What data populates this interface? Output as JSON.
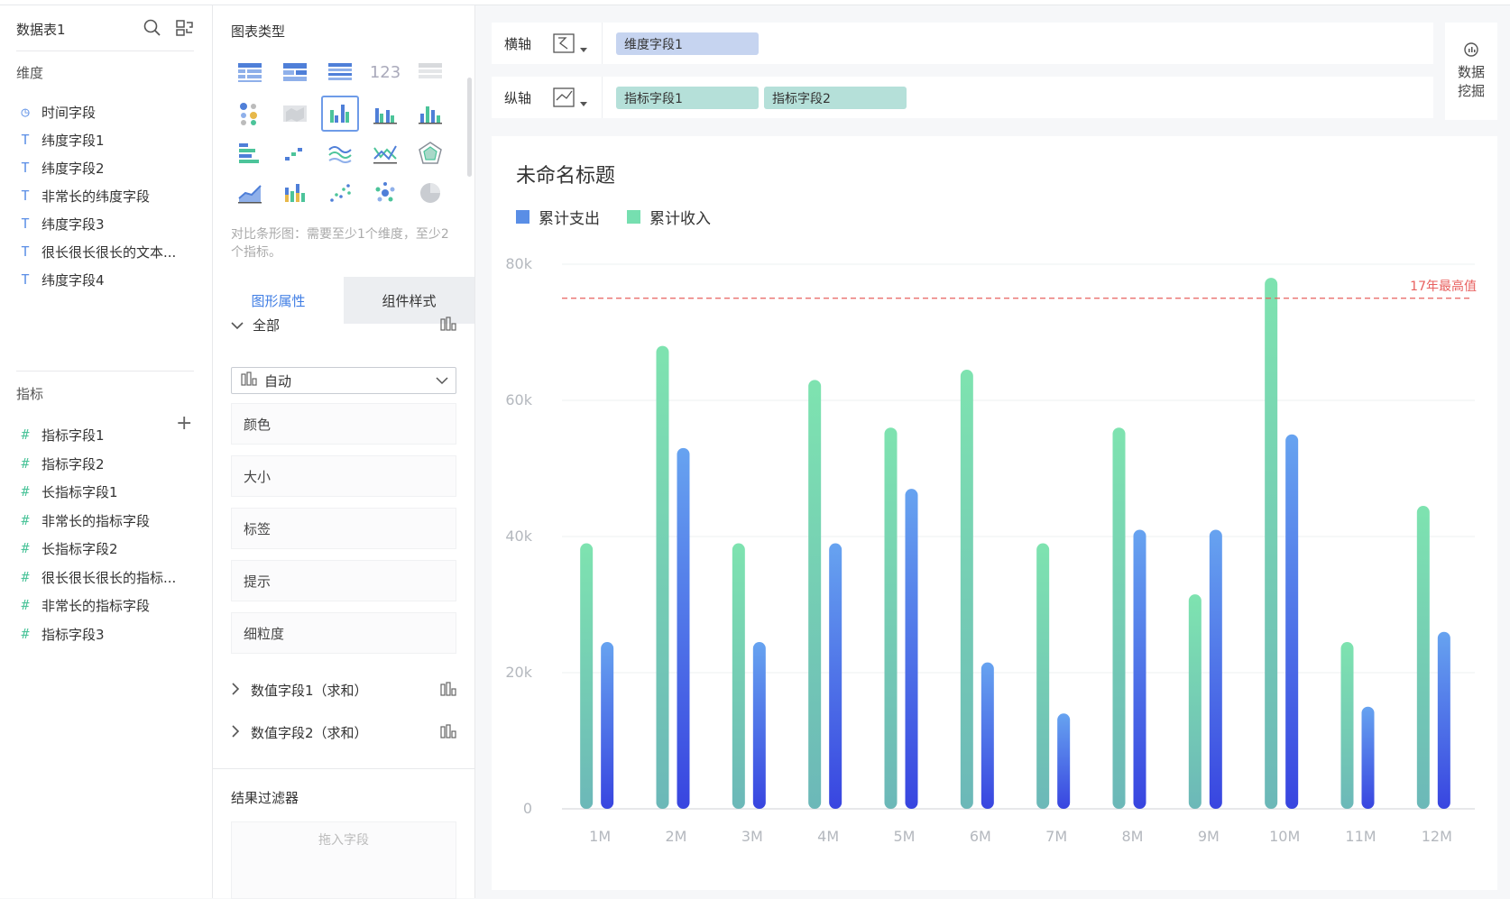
{
  "left_panel": {
    "title": "数据表1",
    "dimension_section": "维度",
    "dimensions": [
      {
        "icon": "clock-icon",
        "glyph": "◷",
        "label": "时间字段"
      },
      {
        "icon": "text-type-icon",
        "glyph": "T",
        "label": "纬度字段1"
      },
      {
        "icon": "text-type-icon",
        "glyph": "T",
        "label": "纬度字段2"
      },
      {
        "icon": "text-type-icon",
        "glyph": "T",
        "label": "非常长的纬度字段"
      },
      {
        "icon": "text-type-icon",
        "glyph": "T",
        "label": "纬度字段3"
      },
      {
        "icon": "text-type-icon",
        "glyph": "T",
        "label": "很长很长很长的文本..."
      },
      {
        "icon": "text-type-icon",
        "glyph": "T",
        "label": "纬度字段4"
      }
    ],
    "metric_section": "指标",
    "add_glyph": "+",
    "metrics": [
      {
        "glyph": "#",
        "label": "指标字段1"
      },
      {
        "glyph": "#",
        "label": "指标字段2"
      },
      {
        "glyph": "#",
        "label": "长指标字段1"
      },
      {
        "glyph": "#",
        "label": "非常长的指标字段"
      },
      {
        "glyph": "#",
        "label": "长指标字段2"
      },
      {
        "glyph": "#",
        "label": "很长很长很长的指标..."
      },
      {
        "glyph": "#",
        "label": "非常长的指标字段"
      },
      {
        "glyph": "#",
        "label": "指标字段3"
      }
    ]
  },
  "middle_panel": {
    "chart_type_title": "图表类型",
    "chart_type_hint": "对比条形图：需要至少1个维度，至少2个指标。",
    "tab_graphic": "图形属性",
    "tab_component": "组件样式",
    "all_label": "全部",
    "auto_select": "自动",
    "props": [
      "颜色",
      "大小",
      "标签",
      "提示",
      "细粒度"
    ],
    "value_field_1": "数值字段1（求和）",
    "value_field_2": "数值字段2（求和）",
    "filter_title": "结果过滤器",
    "drop_placeholder": "拖入字段"
  },
  "axes": {
    "x_label": "横轴",
    "x_field": "维度字段1",
    "y_label": "纵轴",
    "y_field_1": "指标字段1",
    "y_field_2": "指标字段2"
  },
  "data_mining": {
    "line1": "数据",
    "line2": "挖掘"
  },
  "colors": {
    "accent": "#3f7de4",
    "income_top": "#7ee3b0",
    "income_bottom": "#6cb8b8",
    "expense_top": "#67a3f0",
    "expense_bottom": "#3845e0",
    "refline": "#e8605f"
  },
  "chart_data": {
    "type": "bar",
    "title": "未命名标题",
    "categories": [
      "1M",
      "2M",
      "3M",
      "4M",
      "5M",
      "6M",
      "7M",
      "8M",
      "9M",
      "10M",
      "11M",
      "12M"
    ],
    "series": [
      {
        "name": "累计收入",
        "values": [
          39000,
          68000,
          39000,
          63000,
          56000,
          64500,
          39000,
          56000,
          31500,
          78000,
          24500,
          44500
        ]
      },
      {
        "name": "累计支出",
        "values": [
          24500,
          53000,
          24500,
          39000,
          47000,
          21500,
          14000,
          41000,
          41000,
          55000,
          15000,
          26000
        ]
      }
    ],
    "y_ticks": [
      "0",
      "20k",
      "40k",
      "60k",
      "80k"
    ],
    "ylim": [
      0,
      80000
    ],
    "reference_line": {
      "label": "17年最高值",
      "value": 75000
    },
    "legend_position": "top-left",
    "grid": true
  }
}
